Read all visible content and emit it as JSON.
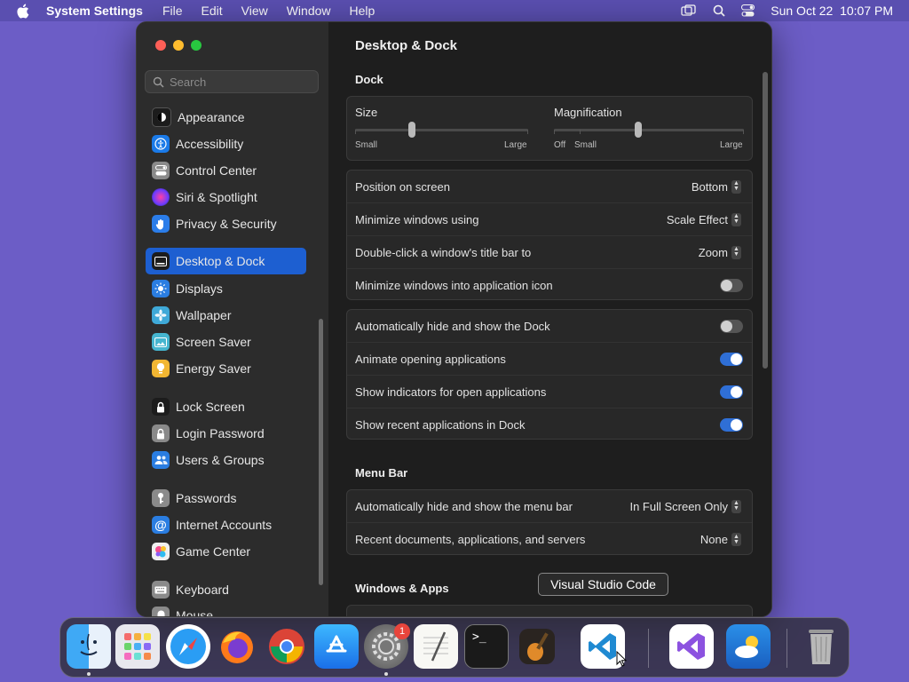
{
  "menubar": {
    "app_name": "System Settings",
    "items": [
      "File",
      "Edit",
      "View",
      "Window",
      "Help"
    ],
    "datetime": "Sun Oct 22  10:07 PM",
    "icons": [
      "apple-icon",
      "screen-mirroring-icon",
      "spotlight-search-icon",
      "control-center-icon"
    ]
  },
  "sidebar": {
    "search_placeholder": "Search",
    "items": [
      {
        "label": "Appearance",
        "icon": "appearance-icon",
        "color": "#1c1c1c"
      },
      {
        "label": "Accessibility",
        "icon": "accessibility-icon",
        "color": "#1a7ae8"
      },
      {
        "label": "Control Center",
        "icon": "control-center-icon",
        "color": "#8a8a8a"
      },
      {
        "label": "Siri & Spotlight",
        "icon": "siri-icon",
        "color": "#8e44ad"
      },
      {
        "label": "Privacy & Security",
        "icon": "hand-icon",
        "color": "#2b7de9"
      },
      {
        "label": "Desktop & Dock",
        "icon": "desktop-dock-icon",
        "color": "#1c1c1c"
      },
      {
        "label": "Displays",
        "icon": "displays-icon",
        "color": "#2a7de1"
      },
      {
        "label": "Wallpaper",
        "icon": "wallpaper-icon",
        "color": "#3fa9d8"
      },
      {
        "label": "Screen Saver",
        "icon": "screen-saver-icon",
        "color": "#45b5cf"
      },
      {
        "label": "Energy Saver",
        "icon": "energy-saver-icon",
        "color": "#f2b632"
      },
      {
        "label": "Lock Screen",
        "icon": "lock-screen-icon",
        "color": "#1c1c1c"
      },
      {
        "label": "Login Password",
        "icon": "lock-icon",
        "color": "#8a8a8a"
      },
      {
        "label": "Users & Groups",
        "icon": "users-icon",
        "color": "#2a7de1"
      },
      {
        "label": "Passwords",
        "icon": "key-icon",
        "color": "#8a8a8a"
      },
      {
        "label": "Internet Accounts",
        "icon": "at-icon",
        "color": "#2a7de1"
      },
      {
        "label": "Game Center",
        "icon": "game-center-icon",
        "color": "#f0f0f0"
      },
      {
        "label": "Keyboard",
        "icon": "keyboard-icon",
        "color": "#8a8a8a"
      },
      {
        "label": "Mouse",
        "icon": "mouse-icon",
        "color": "#8a8a8a"
      }
    ],
    "selected": "Desktop & Dock"
  },
  "content": {
    "title": "Desktop & Dock",
    "dock_section": "Dock",
    "size": {
      "label": "Size",
      "min_label": "Small",
      "max_label": "Large",
      "value_fraction": 0.33
    },
    "magnification": {
      "label": "Magnification",
      "off_label": "Off",
      "min_label": "Small",
      "max_label": "Large",
      "value_fraction": 0.44
    },
    "dock_rows": [
      {
        "label": "Position on screen",
        "value": "Bottom"
      },
      {
        "label": "Minimize windows using",
        "value": "Scale Effect"
      },
      {
        "label": "Double-click a window's title bar to",
        "value": "Zoom"
      },
      {
        "label": "Minimize windows into application icon",
        "toggle": false
      }
    ],
    "dock_toggles": [
      {
        "label": "Automatically hide and show the Dock",
        "toggle": false
      },
      {
        "label": "Animate opening applications",
        "toggle": true
      },
      {
        "label": "Show indicators for open applications",
        "toggle": true
      },
      {
        "label": "Show recent applications in Dock",
        "toggle": true
      }
    ],
    "menubar_section": "Menu Bar",
    "menubar_rows": [
      {
        "label": "Automatically hide and show the menu bar",
        "value": "In Full Screen Only"
      },
      {
        "label": "Recent documents, applications, and servers",
        "value": "None"
      }
    ],
    "windows_section": "Windows & Apps"
  },
  "dock": {
    "tooltip": "Visual Studio Code",
    "badge": "1",
    "apps": [
      "Finder",
      "Launchpad",
      "Safari",
      "Firefox",
      "Chrome",
      "App Store",
      "System Settings",
      "TextEdit",
      "Terminal",
      "GarageBand",
      "Visual Studio Code",
      "Visual Studio",
      "Weather",
      "Trash"
    ]
  }
}
